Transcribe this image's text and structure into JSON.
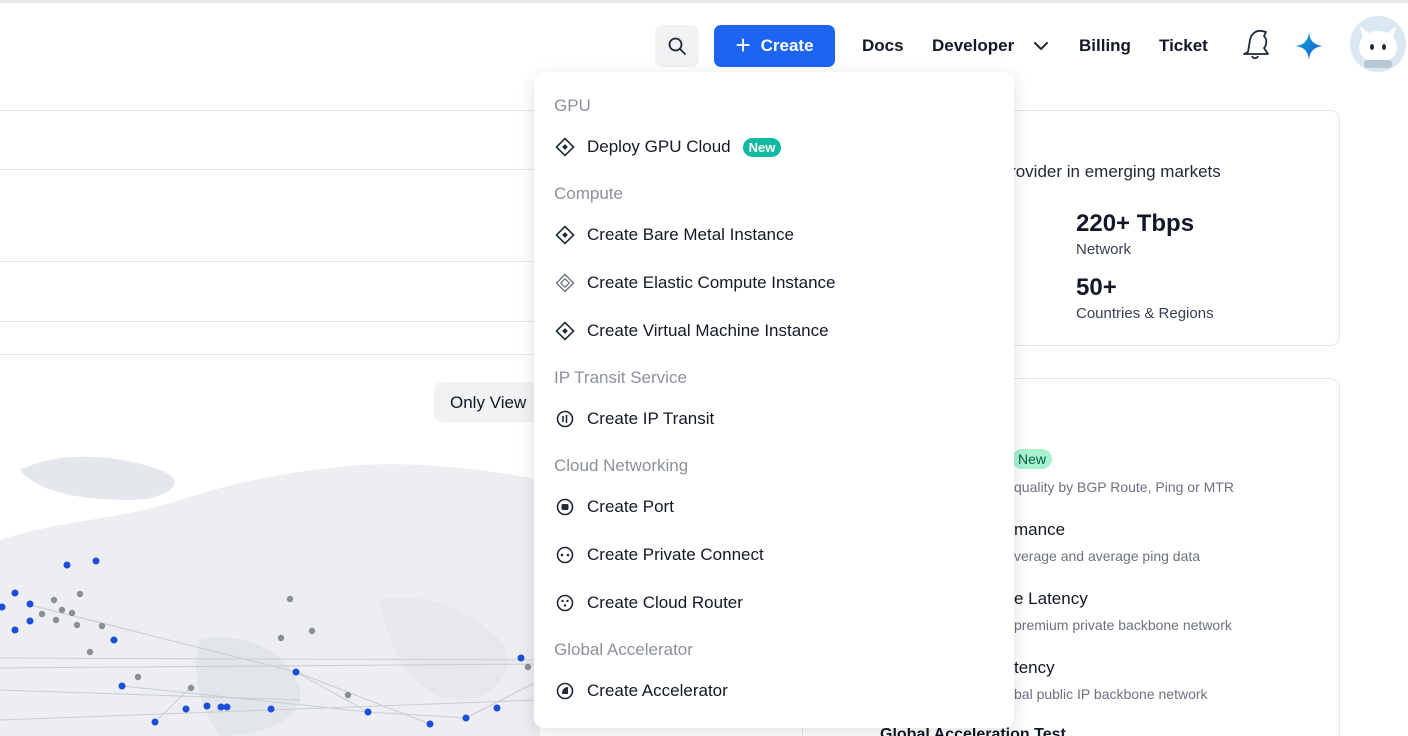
{
  "header": {
    "search_icon": "search-icon",
    "create_label": "Create",
    "nav": {
      "docs": "Docs",
      "developer": "Developer",
      "billing": "Billing",
      "ticket": "Ticket"
    }
  },
  "create_menu": {
    "sections": [
      {
        "title": "GPU",
        "items": [
          {
            "label": "Deploy GPU Cloud",
            "badge": "New",
            "icon": "diamond-icon"
          }
        ]
      },
      {
        "title": "Compute",
        "items": [
          {
            "label": "Create Bare Metal Instance",
            "icon": "diamond-icon"
          },
          {
            "label": "Create Elastic Compute Instance",
            "icon": "diamond-outline-icon"
          },
          {
            "label": "Create Virtual Machine Instance",
            "icon": "diamond-icon"
          }
        ]
      },
      {
        "title": "IP Transit Service",
        "items": [
          {
            "label": "Create IP Transit",
            "icon": "ip-transit-icon"
          }
        ]
      },
      {
        "title": "Cloud Networking",
        "items": [
          {
            "label": "Create Port",
            "icon": "port-icon"
          },
          {
            "label": "Create Private Connect",
            "icon": "private-connect-icon"
          },
          {
            "label": "Create Cloud Router",
            "icon": "cloud-router-icon"
          }
        ]
      },
      {
        "title": "Global Accelerator",
        "items": [
          {
            "label": "Create Accelerator",
            "icon": "accelerator-icon"
          }
        ]
      }
    ]
  },
  "map_panel": {
    "toggle_label": "Only View"
  },
  "stats_card": {
    "tagline": "rvice provider in emerging markets",
    "stats": [
      {
        "value": "220+ Tbps",
        "label": "Network"
      },
      {
        "value": "50+",
        "label": "Countries & Regions"
      }
    ]
  },
  "tools_card": {
    "badge": "New",
    "items": [
      {
        "title": "",
        "desc": "quality by BGP Route, Ping or MTR"
      },
      {
        "title": "mance",
        "desc": "verage and average ping data"
      },
      {
        "title": "e Latency",
        "desc": "premium private backbone network"
      },
      {
        "title": "tency",
        "desc": "bal public IP backbone network"
      }
    ],
    "cut_title": "Global Acceleration Test"
  },
  "colors": {
    "primary": "#1c64f2",
    "badge_new": "#10b9a0",
    "map_dot_blue": "#1d4ed8",
    "map_dot_gray": "#8a8f96"
  }
}
